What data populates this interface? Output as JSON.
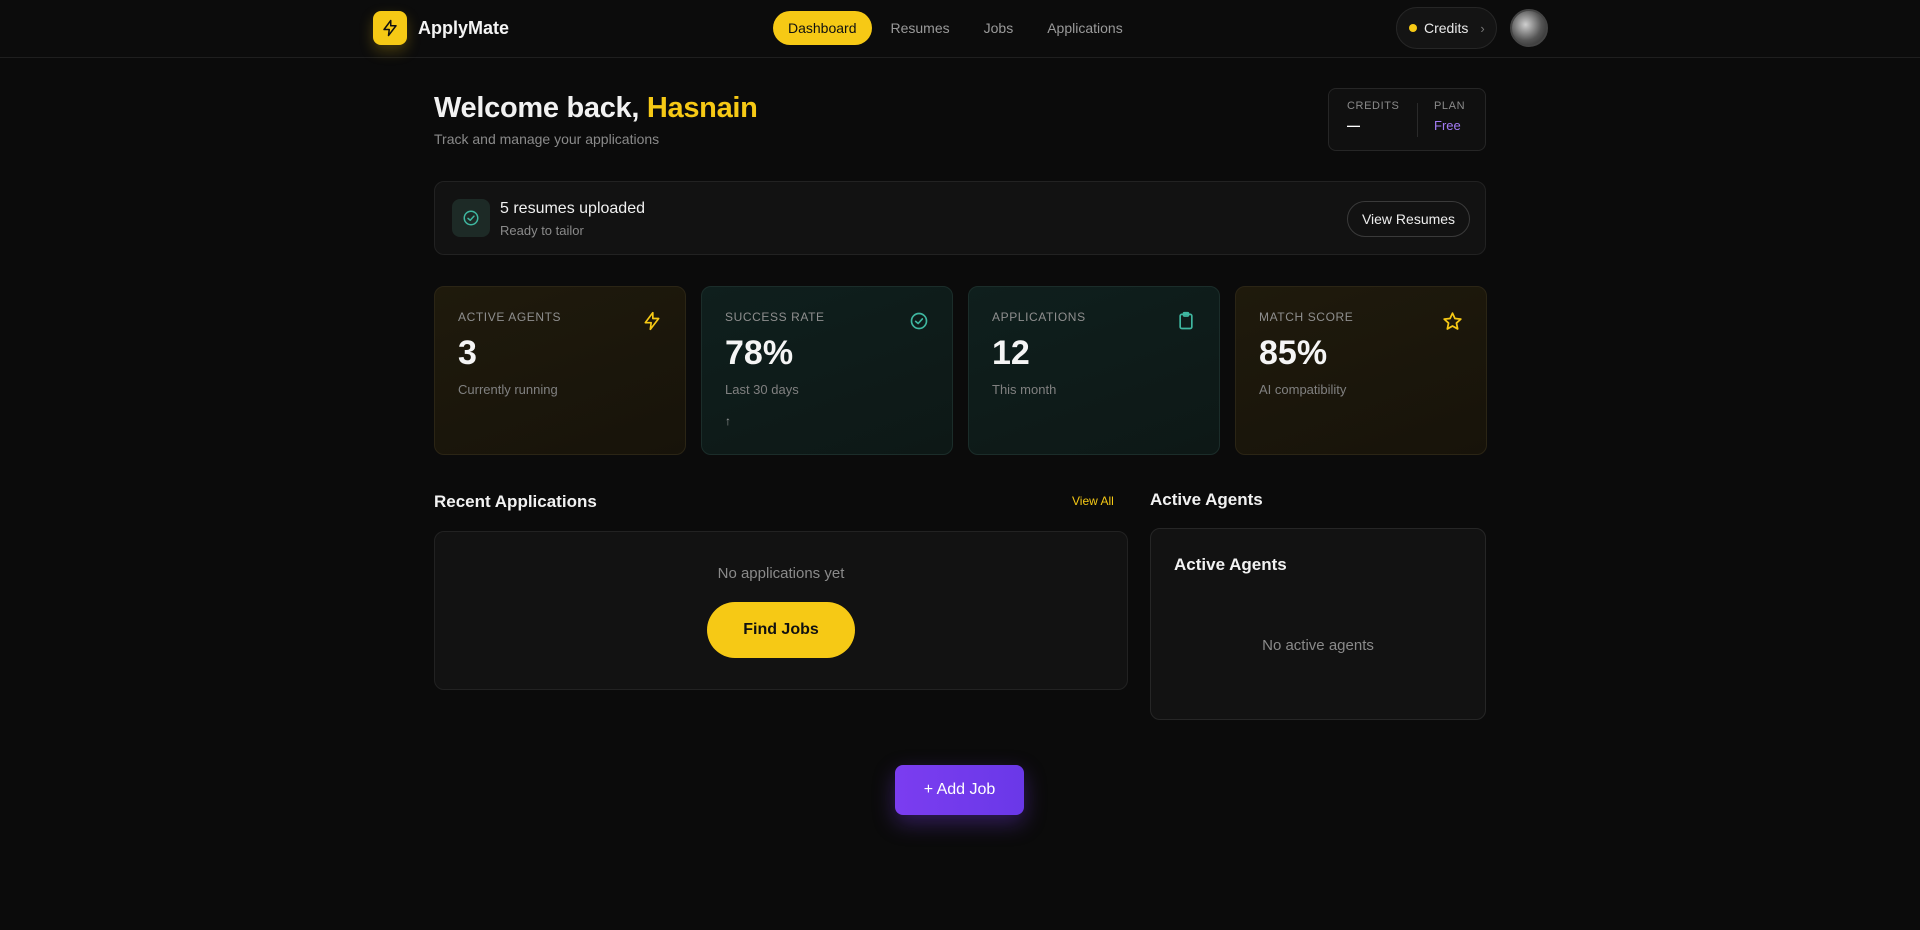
{
  "nav": {
    "brand": "ApplyMate",
    "links": [
      "Dashboard",
      "Resumes",
      "Jobs",
      "Applications"
    ],
    "active_link": "Dashboard",
    "credits_label": "Credits",
    "credits_chevron": "›"
  },
  "header": {
    "welcome_prefix": "Welcome back, ",
    "user_name": "Hasnain",
    "subtitle": "Track and manage your applications",
    "credits_label": "CREDITS",
    "credits_value": "—",
    "plan_label": "PLAN",
    "plan_value": "Free"
  },
  "resume_banner": {
    "title": "5 resumes uploaded",
    "subtitle": "Ready to tailor",
    "button": "View Resumes"
  },
  "stats": [
    {
      "label": "ACTIVE AGENTS",
      "value": "3",
      "desc": "Currently running",
      "extra": "",
      "icon": "lightning-icon",
      "theme": "yellow"
    },
    {
      "label": "SUCCESS RATE",
      "value": "78%",
      "desc": "Last 30 days",
      "extra": "↑",
      "icon": "check-circle-icon",
      "theme": "teal"
    },
    {
      "label": "APPLICATIONS",
      "value": "12",
      "desc": "This month",
      "extra": "",
      "icon": "clipboard-icon",
      "theme": "teal"
    },
    {
      "label": "MATCH SCORE",
      "value": "85%",
      "desc": "AI compatibility",
      "extra": "",
      "icon": "star-icon",
      "theme": "yellow"
    }
  ],
  "recent_applications": {
    "title": "Recent Applications",
    "view_all": "View All",
    "empty": "No applications yet",
    "button": "Find Jobs"
  },
  "active_agents": {
    "section_title": "Active Agents",
    "card_title": "Active Agents",
    "empty": "No active agents"
  },
  "add_job": "+ Add Job",
  "colors": {
    "accent": "#f6c915",
    "purple": "#7b3df0",
    "teal_icon": "#3fb7a0",
    "plan": "#a47cf7"
  }
}
